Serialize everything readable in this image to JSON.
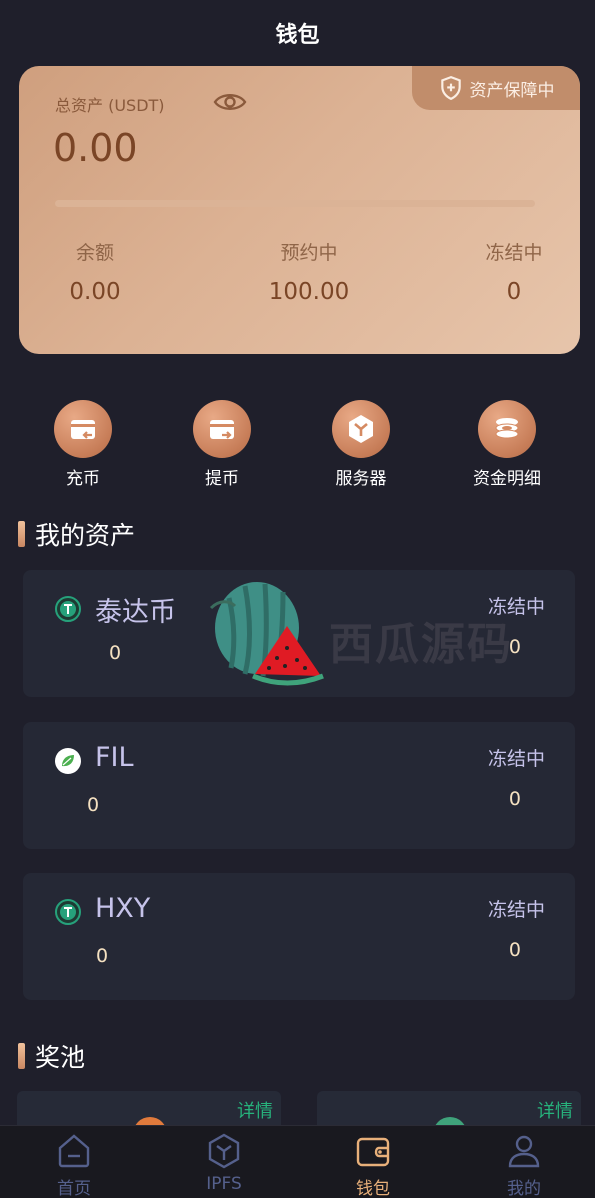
{
  "header": {
    "title": "钱包"
  },
  "card": {
    "badge_label": "资产保障中",
    "total_label": "总资产 (USDT)",
    "total_value": "0.00",
    "progress": 0,
    "stats": [
      {
        "label": "余额",
        "value": "0.00"
      },
      {
        "label": "预约中",
        "value": "100.00"
      },
      {
        "label": "冻结中",
        "value": "0"
      }
    ]
  },
  "actions": [
    {
      "label": "充币",
      "icon": "deposit-icon"
    },
    {
      "label": "提币",
      "icon": "withdraw-icon"
    },
    {
      "label": "服务器",
      "icon": "server-icon"
    },
    {
      "label": "资金明细",
      "icon": "coins-icon"
    }
  ],
  "my_assets": {
    "title": "我的资产",
    "items": [
      {
        "name": "泰达币",
        "amount": "0",
        "frozen_label": "冻结中",
        "frozen_value": "0",
        "icon": "tether-icon",
        "color": "#26a17b"
      },
      {
        "name": "FIL",
        "amount": "0",
        "frozen_label": "冻结中",
        "frozen_value": "0",
        "icon": "leaf-icon",
        "color": "#4caf50"
      },
      {
        "name": "HXY",
        "amount": "0",
        "frozen_label": "冻结中",
        "frozen_value": "0",
        "icon": "tether-icon",
        "color": "#26a17b"
      }
    ]
  },
  "pool": {
    "title": "奖池",
    "cards": [
      {
        "detail_label": "详情",
        "color": "#e07a3c"
      },
      {
        "detail_label": "详情",
        "color": "#3fa37b"
      }
    ]
  },
  "watermark": {
    "text": "西瓜源码"
  },
  "tabbar": {
    "tabs": [
      {
        "label": "首页",
        "icon": "home-icon",
        "active": false
      },
      {
        "label": "IPFS",
        "icon": "ipfs-icon",
        "active": false
      },
      {
        "label": "钱包",
        "icon": "wallet-icon",
        "active": true
      },
      {
        "label": "我的",
        "icon": "user-icon",
        "active": false
      }
    ]
  },
  "colors": {
    "accent": "#e8b07a",
    "background": "#1f1f2b",
    "card": "#252835"
  }
}
